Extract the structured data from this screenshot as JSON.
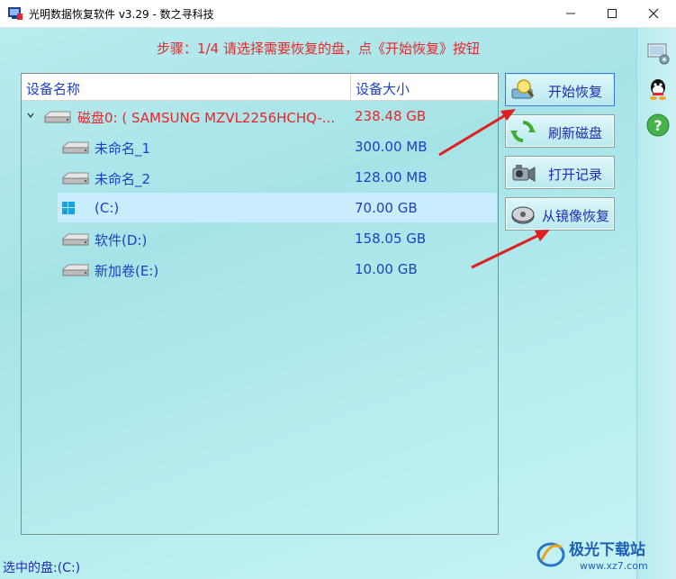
{
  "window": {
    "title": "光明数据恢复软件 v3.29 - 数之寻科技"
  },
  "step_text": "步骤：1/4 请选择需要恢复的盘，点《开始恢复》按钮",
  "table": {
    "columns": [
      "设备名称",
      "设备大小"
    ],
    "rows": [
      {
        "name": "磁盘0: ( SAMSUNG MZVL2256HCHQ-...",
        "size": "238.48 GB",
        "kind": "disk"
      },
      {
        "name": "未命名_1",
        "size": "300.00 MB",
        "kind": "partition"
      },
      {
        "name": "未命名_2",
        "size": "128.00 MB",
        "kind": "partition"
      },
      {
        "name": "(C:)",
        "size": "70.00 GB",
        "kind": "system",
        "selected": true
      },
      {
        "name": "软件(D:)",
        "size": "158.05 GB",
        "kind": "partition"
      },
      {
        "name": "新加卷(E:)",
        "size": "10.00 GB",
        "kind": "partition"
      }
    ]
  },
  "buttons": {
    "start_recovery": "开始恢复",
    "refresh_disk": "刷新磁盘",
    "open_record": "打开记录",
    "recover_from_image": "从镜像恢复"
  },
  "status_text": "选中的盘:(C:)",
  "watermark": {
    "brand": "极光下载站",
    "url": "www.xz7.com"
  },
  "colors": {
    "accent_red": "#e8262b",
    "text_blue": "#1e40c8",
    "background": "#b9ecef"
  },
  "icons": {
    "sidebar": [
      "settings-icon",
      "qq-icon",
      "help-icon"
    ]
  }
}
